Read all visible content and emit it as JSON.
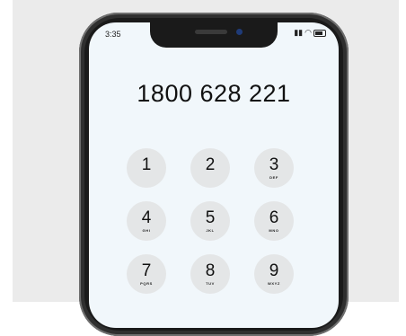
{
  "status_bar": {
    "time": "3:35",
    "signal": "▮▮",
    "wifi": "◠"
  },
  "dialer": {
    "number": "1800 628 221"
  },
  "keypad": {
    "keys": [
      {
        "digit": "1",
        "letters": ""
      },
      {
        "digit": "2",
        "letters": ""
      },
      {
        "digit": "3",
        "letters": "DEF"
      },
      {
        "digit": "4",
        "letters": "GHI"
      },
      {
        "digit": "5",
        "letters": "JKL"
      },
      {
        "digit": "6",
        "letters": "MNO"
      },
      {
        "digit": "7",
        "letters": "PQRS"
      },
      {
        "digit": "8",
        "letters": "TUV"
      },
      {
        "digit": "9",
        "letters": "WXYZ"
      }
    ]
  }
}
